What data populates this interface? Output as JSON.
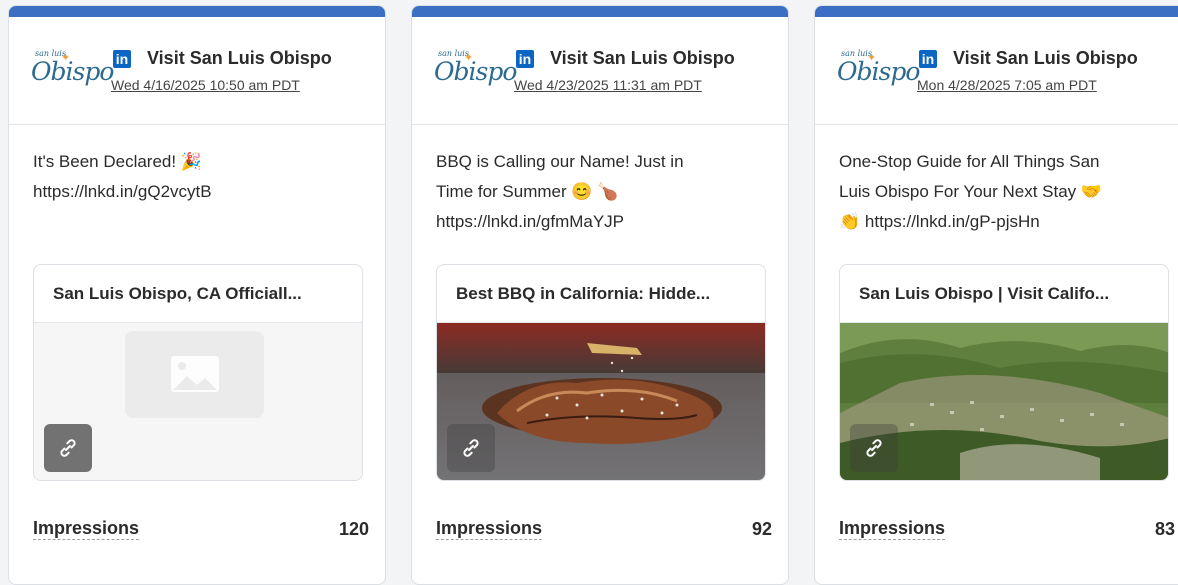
{
  "colors": {
    "accent_bar": "#3a6fc4",
    "linkedin": "#0a66c2"
  },
  "cards": [
    {
      "logo": {
        "small": "san luis",
        "big": "Obispo"
      },
      "network_icon": "linkedin-icon",
      "author": "Visit San Luis Obispo",
      "date": "Wed 4/16/2025 10:50 am PDT",
      "text_line1": "It's Been Declared! 🎉",
      "text_line2": "https://lnkd.in/gQ2vcytB",
      "text_line3": "",
      "preview_title": "San Luis Obispo, CA Officiall...",
      "preview_media": "image-placeholder-icon",
      "link_icon": "link-icon",
      "metric_label": "Impressions",
      "metric_value": "120"
    },
    {
      "logo": {
        "small": "san luis",
        "big": "Obispo"
      },
      "network_icon": "linkedin-icon",
      "author": "Visit San Luis Obispo",
      "date": "Wed 4/23/2025 11:31 am PDT",
      "text_line1": "BBQ is Calling our Name! Just in",
      "text_line2": "Time for Summer 😊 🍗",
      "text_line3": "https://lnkd.in/gfmMaYJP",
      "preview_title": "Best BBQ in California: Hidde...",
      "preview_media": "bbq-steak-photo",
      "link_icon": "link-icon",
      "metric_label": "Impressions",
      "metric_value": "92"
    },
    {
      "logo": {
        "small": "san luis",
        "big": "Obispo"
      },
      "network_icon": "linkedin-icon",
      "author": "Visit San Luis Obispo",
      "date": "Mon 4/28/2025 7:05 am PDT",
      "text_line1": "One-Stop Guide for All Things San",
      "text_line2": "Luis Obispo For Your Next Stay 🤝",
      "text_line3": "👏 https://lnkd.in/gP-pjsHn",
      "preview_title": "San Luis Obispo | Visit Califo...",
      "preview_media": "landscape-photo",
      "link_icon": "link-icon",
      "metric_label": "Impressions",
      "metric_value": "83"
    }
  ]
}
